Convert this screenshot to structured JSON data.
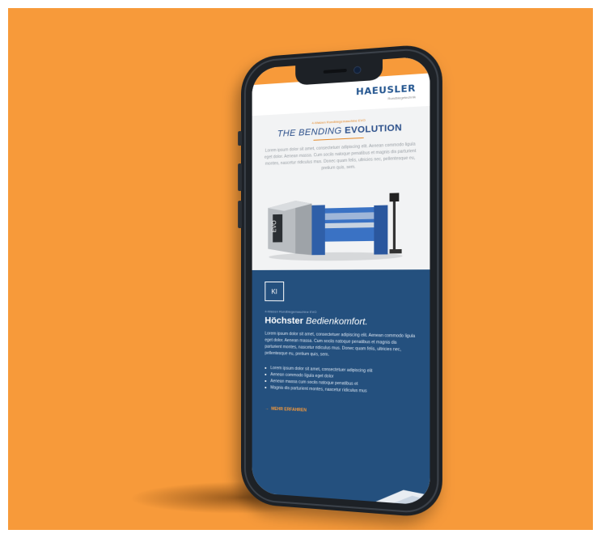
{
  "colors": {
    "background": "#f79a3a",
    "brand_blue": "#23558f",
    "section_blue": "#24507e",
    "accent_orange": "#e58a2a"
  },
  "header": {
    "logo_text": "HAEUSLER",
    "logo_tagline": "Rundbiegetechnik"
  },
  "hero": {
    "eyebrow": "4-Walzen Rundbiegemaschine EVO",
    "title_light": "THE BENDING",
    "title_bold": "EVOLUTION",
    "body": "Lorem ipsum dolor sit amet, consectetuer adipiscing elit. Aenean commodo ligula eget dolor. Aenean massa. Cum sociis natoque penatibus et magnis dis parturient montes, nascetur ridiculus mus. Donec quam felis, ultricies nec, pellentesque eu, pretium quis, sem."
  },
  "feature": {
    "badge": "KI",
    "eyebrow": "4-Walzen Rundbiegemaschine EVO",
    "title_bold": "Höchster",
    "title_italic": "Bedienkomfort.",
    "body": "Lorem ipsum dolor sit amet, consectetuer adipiscing elit. Aenean commodo ligula eget dolor. Aenean massa. Cum sociis natoque penatibus et magnis dis parturient montes, nascetur ridiculus mus. Donec quam felis, ultricies nec, pellentesque eu, pretium quis, sem.",
    "bullets": [
      "Lorem ipsum dolor sit amet, consectetuer adipiscing elit",
      "Aenean commodo ligula eget dolor",
      "Aenean massa cum sociis natoque penatibus et",
      "Magnis dis parturient montes, nascetur ridiculus mus"
    ],
    "cta_arrow": "→",
    "cta_label": "MEHR ERFAHREN"
  }
}
